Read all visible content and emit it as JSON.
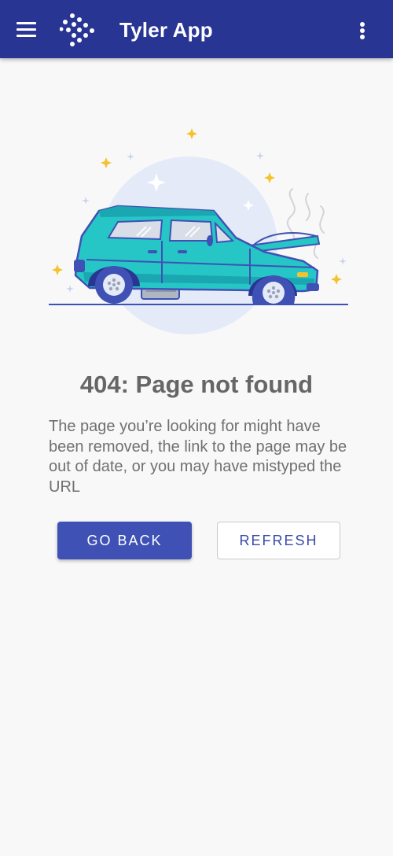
{
  "app": {
    "title": "Tyler App",
    "menu_icon": "hamburger-menu-icon",
    "logo_icon": "dot-diamond-logo-icon",
    "more_icon": "more-vert-icon",
    "bar_color": "#283593"
  },
  "error": {
    "title": "404: Page not found",
    "message": "The page you’re looking for might have been removed, the link to the page may be out of date, or you may have mistyped the URL",
    "illustration": "broken-down-car-illustration"
  },
  "actions": {
    "back_label": "GO BACK",
    "refresh_label": "REFRESH",
    "primary_color": "#3f51b5"
  }
}
